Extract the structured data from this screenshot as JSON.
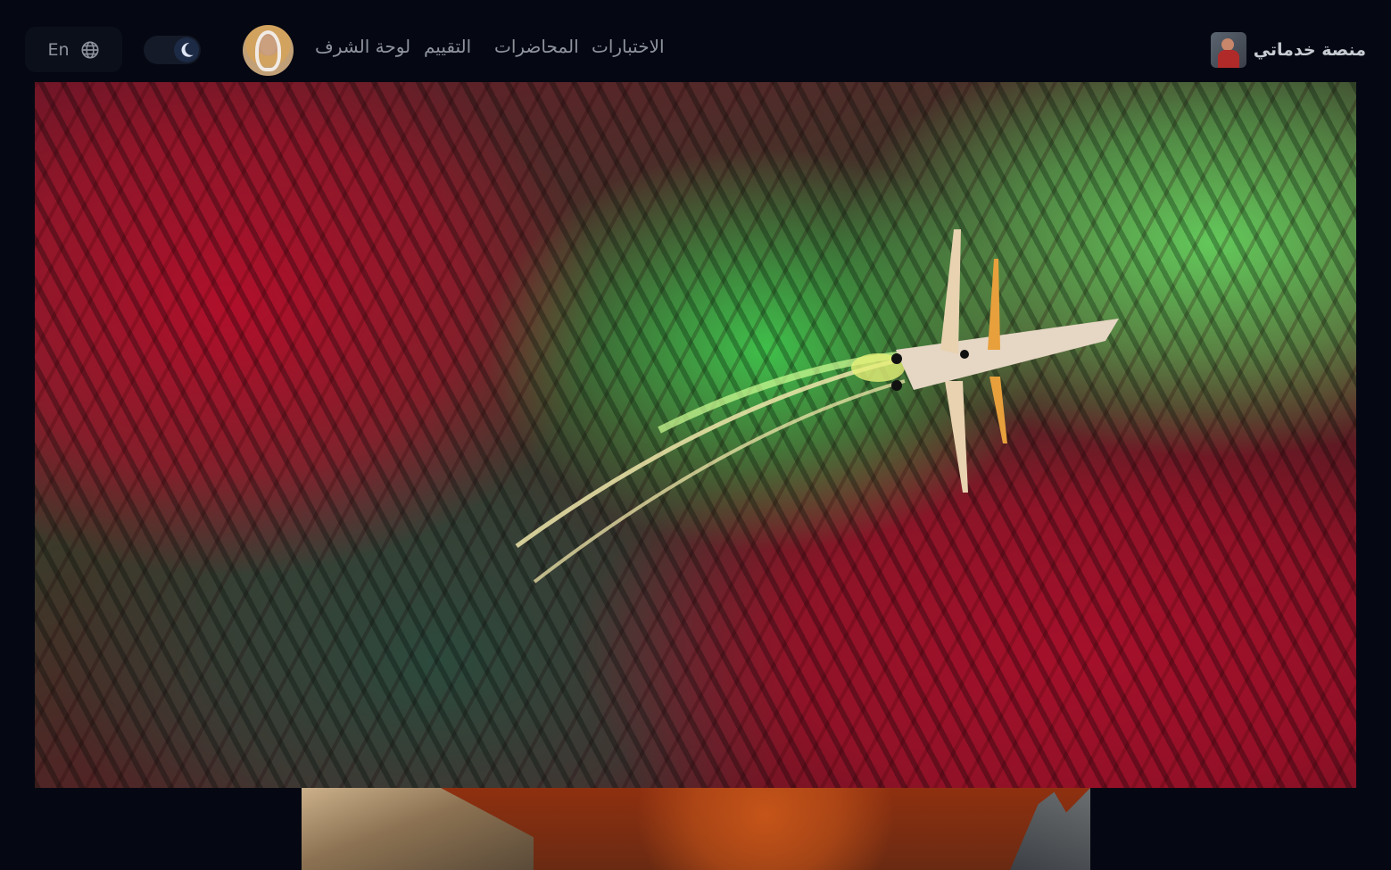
{
  "header": {
    "brand_title": "منصة خدماتي",
    "nav": [
      {
        "label": "الاختبارات",
        "name": "nav-exams"
      },
      {
        "label": "المحاضرات",
        "name": "nav-lectures"
      },
      {
        "label": "التقييم",
        "name": "nav-evaluation"
      },
      {
        "label": "لوحة الشرف",
        "name": "nav-honor-board"
      }
    ],
    "language_label": "En",
    "language_icon": "globe-icon",
    "theme_icon": "moon-icon",
    "theme_mode": "dark"
  },
  "hero": {
    "image": "painted-spaceship-over-alien-forest"
  },
  "colors": {
    "background": "#050812",
    "nav_text": "#8e939d",
    "brand_text": "#c7cbd2"
  }
}
